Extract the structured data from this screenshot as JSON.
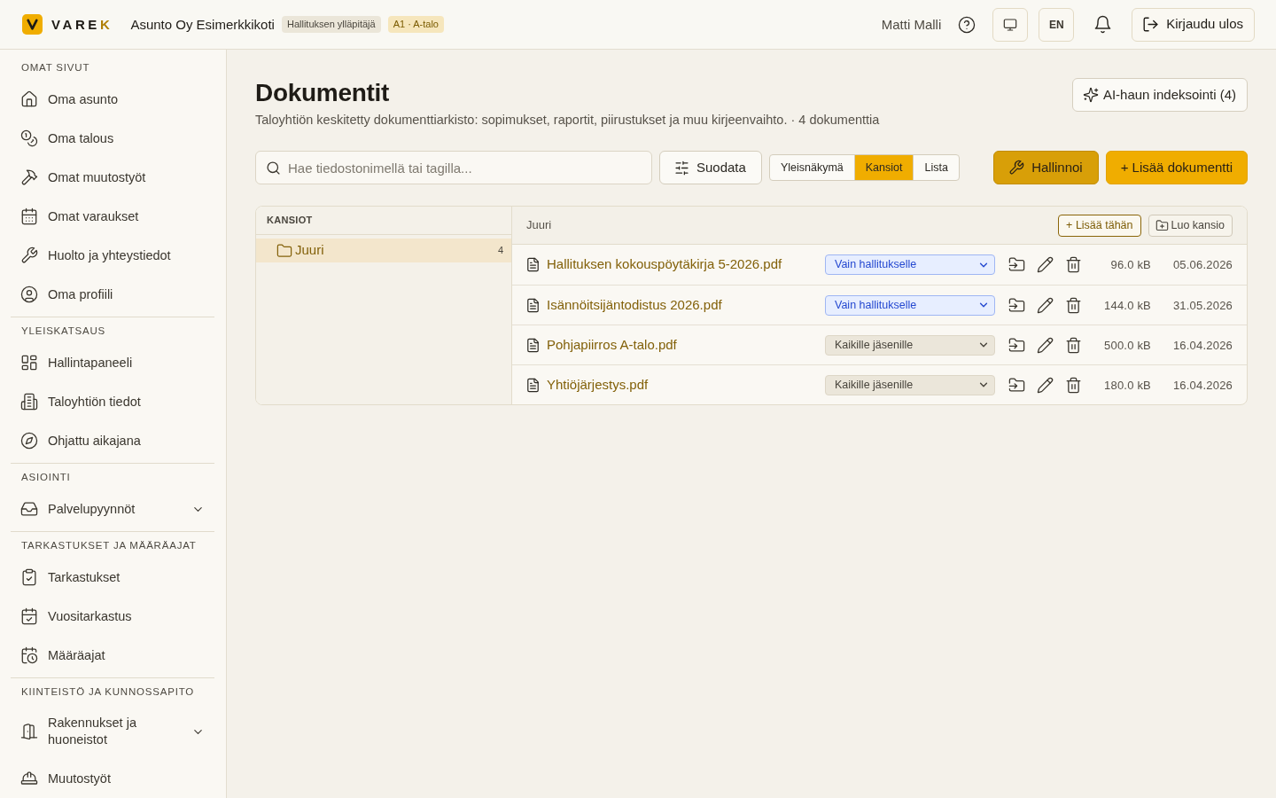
{
  "topbar": {
    "brand": "VAREK",
    "organization": "Asunto Oy Esimerkkikoti",
    "badges": [
      {
        "label": "Hallituksen ylläpitäjä",
        "kind": "role"
      },
      {
        "label": "A1 · A-talo",
        "kind": "unit"
      }
    ],
    "user_name": "Matti Malli",
    "language": "EN",
    "logout": "Kirjaudu ulos"
  },
  "sidebar": {
    "sections": [
      {
        "title": "OMAT SIVUT",
        "items": [
          {
            "label": "Oma asunto",
            "kind": "link"
          },
          {
            "label": "Oma talous",
            "kind": "link"
          },
          {
            "label": "Omat muutostyöt",
            "kind": "link"
          },
          {
            "label": "Omat varaukset",
            "kind": "link"
          },
          {
            "label": "Huolto ja yhteystiedot",
            "kind": "link"
          },
          {
            "label": "Oma profiili",
            "kind": "link"
          }
        ]
      },
      {
        "title": "YLEISKATSAUS",
        "items": [
          {
            "label": "Hallintapaneeli",
            "kind": "link"
          },
          {
            "label": "Taloyhtiön tiedot",
            "kind": "link"
          },
          {
            "label": "Ohjattu aikajana",
            "kind": "link"
          }
        ]
      },
      {
        "title": "ASIOINTI",
        "items": [
          {
            "label": "Palvelupyynnöt",
            "kind": "group"
          }
        ]
      },
      {
        "title": "TARKASTUKSET JA MÄÄRÄAJAT",
        "items": [
          {
            "label": "Tarkastukset",
            "kind": "link"
          },
          {
            "label": "Vuositarkastus",
            "kind": "link"
          },
          {
            "label": "Määräajat",
            "kind": "link"
          }
        ]
      },
      {
        "title": "KIINTEISTÖ JA KUNNOSSAPITO",
        "items": [
          {
            "label": "Rakennukset ja huoneistot",
            "kind": "group"
          },
          {
            "label": "Muutostyöt",
            "kind": "link"
          }
        ]
      }
    ]
  },
  "page": {
    "title": "Dokumentit",
    "description": "Taloyhtiön keskitetty dokumenttiarkisto: sopimukset, raportit, piirustukset ja muu kirjeenvaihto. · 4 dokumenttia",
    "index_button": "AI-haun indeksointi (4)"
  },
  "toolbar": {
    "search": {
      "placeholder": "Hae tiedostonimellä tai tagilla..."
    },
    "filter_button": "Suodata",
    "views": [
      {
        "label": "Yleisnäkymä",
        "selected": false
      },
      {
        "label": "Kansiot",
        "selected": true
      },
      {
        "label": "Lista",
        "selected": false
      }
    ],
    "manage_button": {
      "label": "Hallinnoi",
      "on": true
    },
    "add_button": "+ Lisää dokumentti"
  },
  "folders": {
    "heading": "KANSIOT",
    "items": [
      {
        "name": "Juuri",
        "count": "4",
        "selected": true
      }
    ]
  },
  "files": {
    "path": "Juuri",
    "add_here_button": "+ Lisää tähän",
    "new_folder_button": "Luo kansio",
    "rows": [
      {
        "name": "Hallituksen kokouspöytäkirja 5-2026.pdf",
        "visibility": {
          "value": "Vain hallitukselle",
          "kind": "board"
        },
        "size": "96.0 kB",
        "date": "05.06.2026"
      },
      {
        "name": "Isännöitsijäntodistus 2026.pdf",
        "visibility": {
          "value": "Vain hallitukselle",
          "kind": "board"
        },
        "size": "144.0 kB",
        "date": "31.05.2026"
      },
      {
        "name": "Pohjapiirros A-talo.pdf",
        "visibility": {
          "value": "Kaikille jäsenille",
          "kind": "members"
        },
        "size": "500.0 kB",
        "date": "16.04.2026"
      },
      {
        "name": "Yhtiöjärjestys.pdf",
        "visibility": {
          "value": "Kaikille jäsenille",
          "kind": "members"
        },
        "size": "180.0 kB",
        "date": "16.04.2026"
      }
    ]
  }
}
